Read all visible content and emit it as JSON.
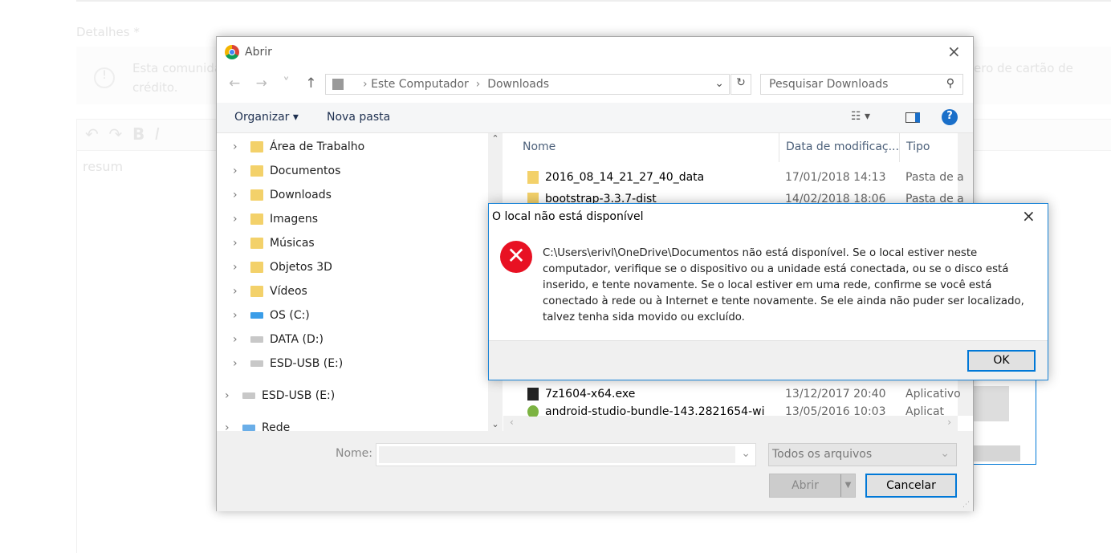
{
  "page": {
    "details_label": "Detalhes *",
    "notice": "Esta comunida",
    "notice_end": "ero de cartão de",
    "notice_line2": "crédito.",
    "editor_text": "resum"
  },
  "dialog": {
    "title": "Abrir",
    "address": [
      "Este Computador",
      "Downloads"
    ],
    "search_placeholder": "Pesquisar Downloads",
    "organize": "Organizar",
    "new_folder": "Nova pasta",
    "nav": [
      {
        "label": "Área de Trabalho",
        "icon": "desktop-folder-icon"
      },
      {
        "label": "Documentos",
        "icon": "documents-icon"
      },
      {
        "label": "Downloads",
        "icon": "downloads-icon"
      },
      {
        "label": "Imagens",
        "icon": "pictures-icon"
      },
      {
        "label": "Músicas",
        "icon": "music-icon"
      },
      {
        "label": "Objetos 3D",
        "icon": "objects3d-icon"
      },
      {
        "label": "Vídeos",
        "icon": "videos-icon"
      },
      {
        "label": "OS (C:)",
        "icon": "drive-icon"
      },
      {
        "label": "DATA (D:)",
        "icon": "drive-icon"
      },
      {
        "label": "ESD-USB (E:)",
        "icon": "usb-drive-icon"
      },
      {
        "label": "ESD-USB (E:)",
        "icon": "usb-drive-icon"
      },
      {
        "label": "Rede",
        "icon": "network-icon"
      }
    ],
    "columns": [
      "Nome",
      "Data de modificaç...",
      "Tipo"
    ],
    "files": [
      {
        "name": "2016_08_14_21_27_40_data",
        "date": "17/01/2018 14:13",
        "type": "Pasta de a"
      },
      {
        "name": "bootstrap-3.3.7-dist",
        "date": "14/02/2018 18:06",
        "type": "Pasta de a"
      },
      {
        "name": "7z1604-x64.exe",
        "date": "13/12/2017 20:40",
        "type": "Aplicativo"
      },
      {
        "name": "android-studio-bundle-143.2821654-wi",
        "date": "13/05/2016 10:03",
        "type": "Aplicativo"
      }
    ],
    "filename_label": "Nome:",
    "filename_value": "",
    "filetype": "Todos os arquivos",
    "open": "Abrir",
    "cancel": "Cancelar"
  },
  "error": {
    "title": "O local não está disponível",
    "message": "C:\\Users\\erivl\\OneDrive\\Documentos não está disponível. Se o local estiver neste computador, verifique se o dispositivo ou a unidade está conectada, ou se o disco está inserido, e tente novamente. Se o local estiver em uma rede, confirme se você está conectado à rede ou à Internet e tente novamente. Se ele ainda não puder ser localizado, talvez tenha sida movido ou excluído.",
    "ok": "OK",
    "icon": "error-icon",
    "color": "#e81123"
  }
}
